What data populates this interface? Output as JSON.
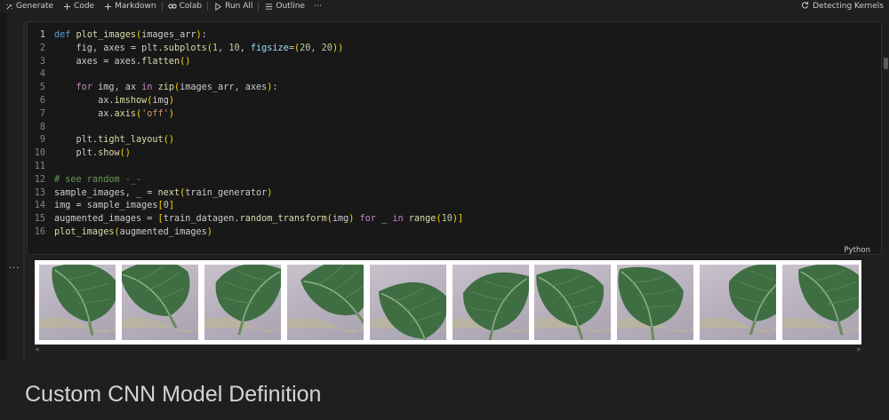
{
  "toolbar": {
    "generate": "Generate",
    "code": "Code",
    "markdown": "Markdown",
    "colab": "Colab",
    "run_all": "Run All",
    "outline": "Outline",
    "more": "⋯",
    "kernel_status": "Detecting Kernels"
  },
  "code_cell": {
    "language": "Python",
    "line_numbers": [
      "1",
      "2",
      "3",
      "4",
      "5",
      "6",
      "7",
      "8",
      "9",
      "10",
      "11",
      "12",
      "13",
      "14",
      "15",
      "16"
    ],
    "lines": [
      "def plot_images(images_arr):",
      "    fig, axes = plt.subplots(1, 10, figsize=(20, 20))",
      "    axes = axes.flatten()",
      "",
      "    for img, ax in zip(images_arr, axes):",
      "        ax.imshow(img)",
      "        ax.axis('off')",
      "",
      "    plt.tight_layout()",
      "    plt.show()",
      "",
      "# see random -_-",
      "sample_images, _ = next(train_generator)",
      "img = sample_images[0]",
      "augmented_images = [train_datagen.random_transform(img) for _ in range(10)]",
      "plot_images(augmented_images)"
    ]
  },
  "output": {
    "dots": "...",
    "images": [
      {
        "name": "augmented-image-1"
      },
      {
        "name": "augmented-image-2"
      },
      {
        "name": "augmented-image-3"
      },
      {
        "name": "augmented-image-4"
      },
      {
        "name": "augmented-image-5"
      },
      {
        "name": "augmented-image-6"
      },
      {
        "name": "augmented-image-7"
      },
      {
        "name": "augmented-image-8"
      },
      {
        "name": "augmented-image-9"
      },
      {
        "name": "augmented-image-10"
      }
    ]
  },
  "markdown": {
    "heading": "Custom CNN Model Definition"
  },
  "colors": {
    "background": "#1f1f1f",
    "cell_background": "#181818",
    "leaf_green": "#3f6e43",
    "keyword_blue": "#569cd6",
    "comment_green": "#6a9955"
  }
}
